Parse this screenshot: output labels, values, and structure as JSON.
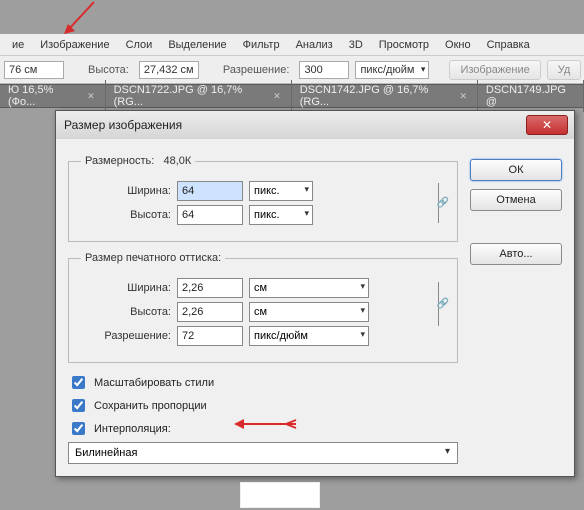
{
  "menu": {
    "items": [
      "ие",
      "Изображение",
      "Слои",
      "Выделение",
      "Фильтр",
      "Анализ",
      "3D",
      "Просмотр",
      "Окно",
      "Справка"
    ]
  },
  "options": {
    "width_value": "76 см",
    "height_label": "Высота:",
    "height_value": "27,432 см",
    "res_label": "Разрешение:",
    "res_value": "300",
    "res_unit": "пикс/дюйм",
    "btn_image": "Изображение",
    "btn_del": "Уд"
  },
  "tabs": [
    {
      "label": "Ю 16,5% (Фо..."
    },
    {
      "label": "DSCN1722.JPG @ 16,7% (RG..."
    },
    {
      "label": "DSCN1742.JPG @ 16,7% (RG..."
    },
    {
      "label": "DSCN1749.JPG @"
    }
  ],
  "dialog": {
    "title": "Размер изображения",
    "dim_legend": "Размерность:",
    "dim_value": "48,0К",
    "width_label": "Ширина:",
    "height_label": "Высота:",
    "px_w": "64",
    "px_h": "64",
    "px_unit": "пикс.",
    "print_legend": "Размер печатного оттиска:",
    "p_width": "2,26",
    "p_height": "2,26",
    "cm_unit": "см",
    "resolution_label": "Разрешение:",
    "resolution": "72",
    "resolution_unit": "пикс/дюйм",
    "chk_scale": "Масштабировать стили",
    "chk_prop": "Сохранить пропорции",
    "chk_interp": "Интерполяция:",
    "interp_value": "Билинейная",
    "ok": "ОК",
    "cancel": "Отмена",
    "auto": "Авто..."
  }
}
